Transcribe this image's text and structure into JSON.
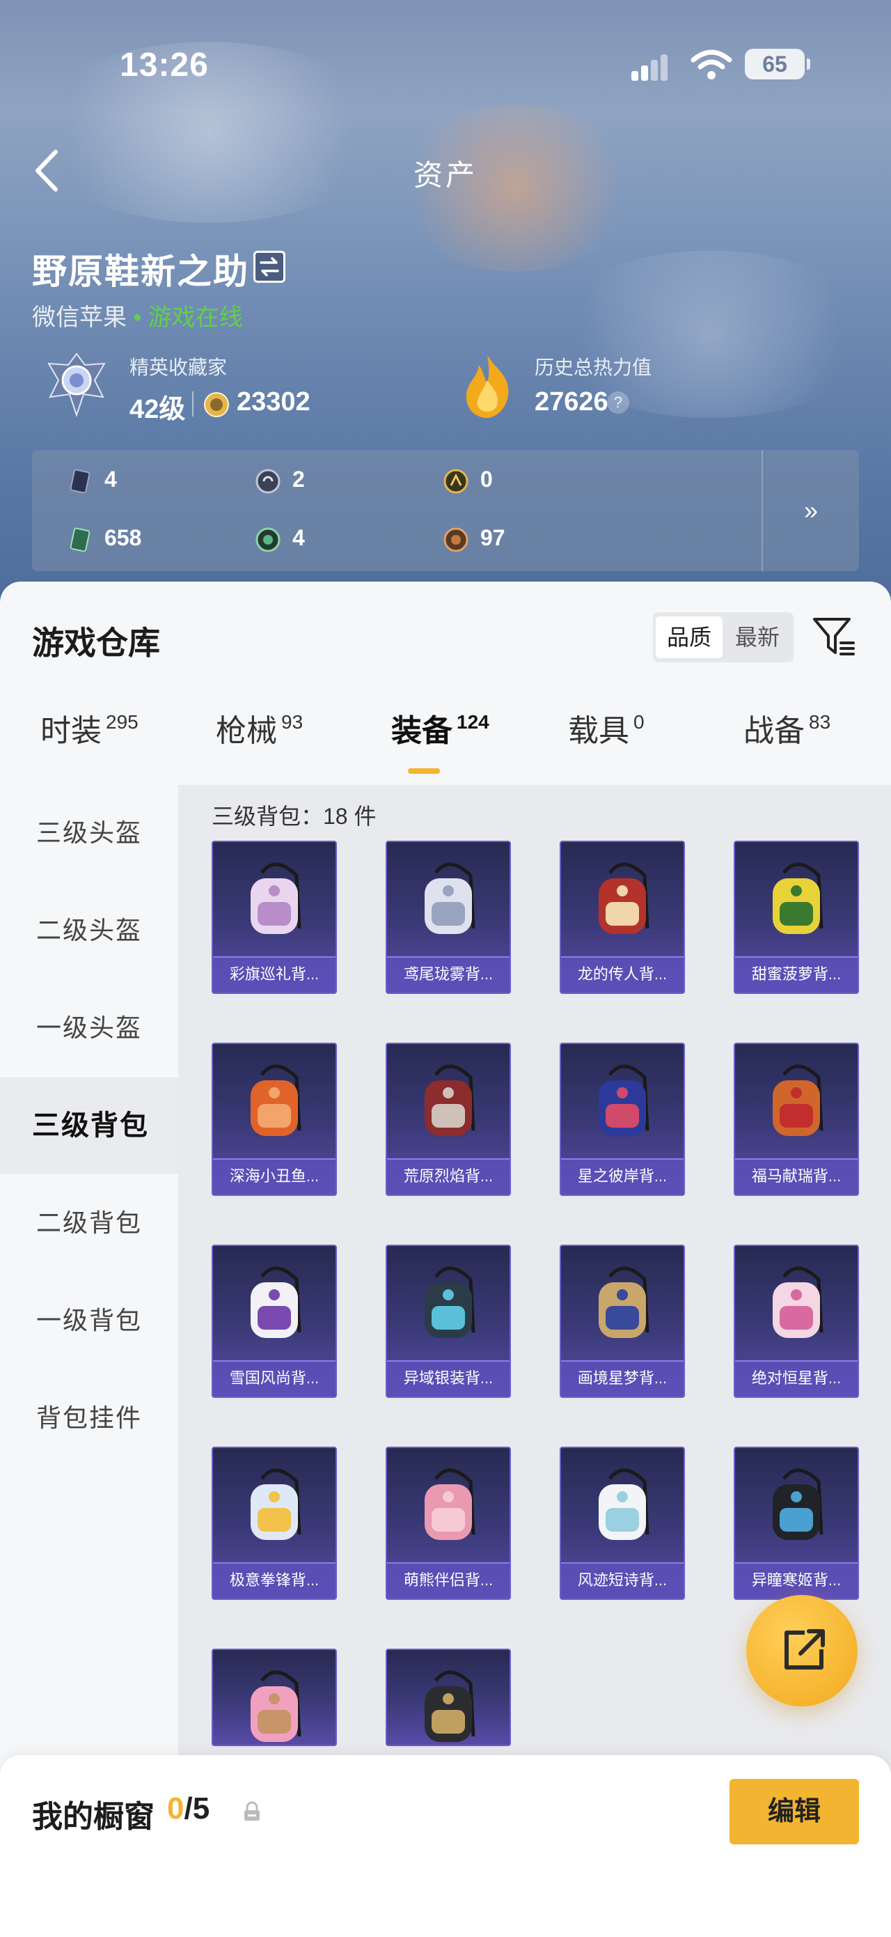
{
  "status_bar": {
    "time": "13:26",
    "battery": "65"
  },
  "nav": {
    "title": "资产"
  },
  "player": {
    "name": "野原鞋新之助",
    "platform": "微信苹果",
    "online_status": "• 游戏在线",
    "rank_title": "精英收藏家",
    "level": "42级",
    "coins": "23302",
    "heat_title": "历史总热力值",
    "heat_value": "27626",
    "help": "?"
  },
  "stats": [
    {
      "icon": "card-icon",
      "value": "4"
    },
    {
      "icon": "silver-token-icon",
      "value": "2"
    },
    {
      "icon": "gold-token-icon",
      "value": "0"
    },
    {
      "icon": "green-card-icon",
      "value": "658"
    },
    {
      "icon": "green-token-icon",
      "value": "4"
    },
    {
      "icon": "bronze-token-icon",
      "value": "97"
    }
  ],
  "stats_more": "»",
  "warehouse": {
    "title": "游戏仓库",
    "sort_options": [
      "品质",
      "最新"
    ],
    "sort_active": "品质",
    "tabs": [
      {
        "label": "时装",
        "count": "295"
      },
      {
        "label": "枪械",
        "count": "93"
      },
      {
        "label": "装备",
        "count": "124"
      },
      {
        "label": "载具",
        "count": "0"
      },
      {
        "label": "战备",
        "count": "83"
      }
    ],
    "active_tab": "装备",
    "categories": [
      "三级头盔",
      "二级头盔",
      "一级头盔",
      "三级背包",
      "二级背包",
      "一级背包",
      "背包挂件"
    ],
    "active_category": "三级背包",
    "caption": "三级背包：18 件",
    "items": [
      {
        "name": "彩旗巡礼背...",
        "icon": "frilly-backpack-icon"
      },
      {
        "name": "鸢尾珑雾背...",
        "icon": "white-pouch-backpack-icon"
      },
      {
        "name": "龙的传人背...",
        "icon": "red-dragon-backpack-icon"
      },
      {
        "name": "甜蜜菠萝背...",
        "icon": "pineapple-backpack-icon"
      },
      {
        "name": "深海小丑鱼...",
        "icon": "clownfish-backpack-icon"
      },
      {
        "name": "荒原烈焰背...",
        "icon": "flame-vest-backpack-icon"
      },
      {
        "name": "星之彼岸背...",
        "icon": "galaxy-backpack-icon"
      },
      {
        "name": "福马献瑞背...",
        "icon": "horse-backpack-icon"
      },
      {
        "name": "雪国风尚背...",
        "icon": "snowman-backpack-icon"
      },
      {
        "name": "异域银装背...",
        "icon": "silver-armor-backpack-icon"
      },
      {
        "name": "画境星梦背...",
        "icon": "frame-backpack-icon"
      },
      {
        "name": "绝对恒星背...",
        "icon": "popcorn-backpack-icon"
      },
      {
        "name": "极意拳锋背...",
        "icon": "fist-backpack-icon"
      },
      {
        "name": "萌熊伴侣背...",
        "icon": "pink-bear-backpack-icon"
      },
      {
        "name": "风迹短诗背...",
        "icon": "white-box-backpack-icon"
      },
      {
        "name": "异瞳寒姬背...",
        "icon": "black-cat-backpack-icon"
      },
      {
        "name": "",
        "icon": "donut-backpack-icon"
      },
      {
        "name": "",
        "icon": "dark-horn-backpack-icon"
      }
    ]
  },
  "showcase": {
    "title": "我的橱窗",
    "current": "0",
    "total": "/5",
    "edit_label": "编辑"
  },
  "colors": {
    "accent": "#f2b431",
    "online": "#5fd04a",
    "item_bg": "#3b3a78"
  }
}
